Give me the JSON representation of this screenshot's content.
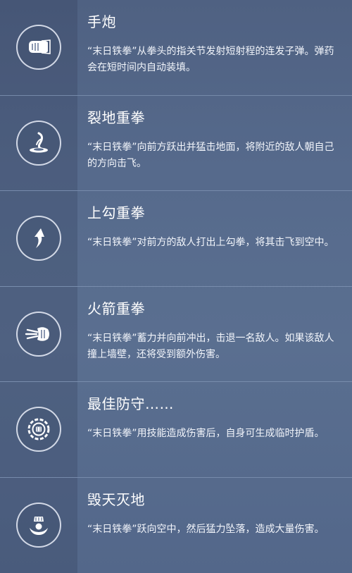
{
  "abilities": [
    {
      "icon": "fist-punch-icon",
      "title": "手炮",
      "desc": "“末日铁拳”从拳头的指关节发射短射程的连发子弹。弹药会在短时间内自动装填。"
    },
    {
      "icon": "ground-slam-icon",
      "title": "裂地重拳",
      "desc": "“末日铁拳”向前方跃出并猛击地面，将附近的敌人朝自己的方向击飞。"
    },
    {
      "icon": "uppercut-arrow-icon",
      "title": "上勾重拳",
      "desc": "“末日铁拳”对前方的敌人打出上勾拳，将其击飞到空中。"
    },
    {
      "icon": "rocket-punch-icon",
      "title": "火箭重拳",
      "desc": "“末日铁拳”蓄力并向前冲出，击退一名敌人。如果该敌人撞上墙壁，还将受到额外伤害。"
    },
    {
      "icon": "shield-ring-icon",
      "title": "最佳防守……",
      "desc": "“末日铁拳”用技能造成伤害后，自身可生成临时护盾。"
    },
    {
      "icon": "meteor-strike-icon",
      "title": "毁天灭地",
      "desc": "“末日铁拳”跃向空中，然后猛力坠落，造成大量伤害。"
    }
  ]
}
